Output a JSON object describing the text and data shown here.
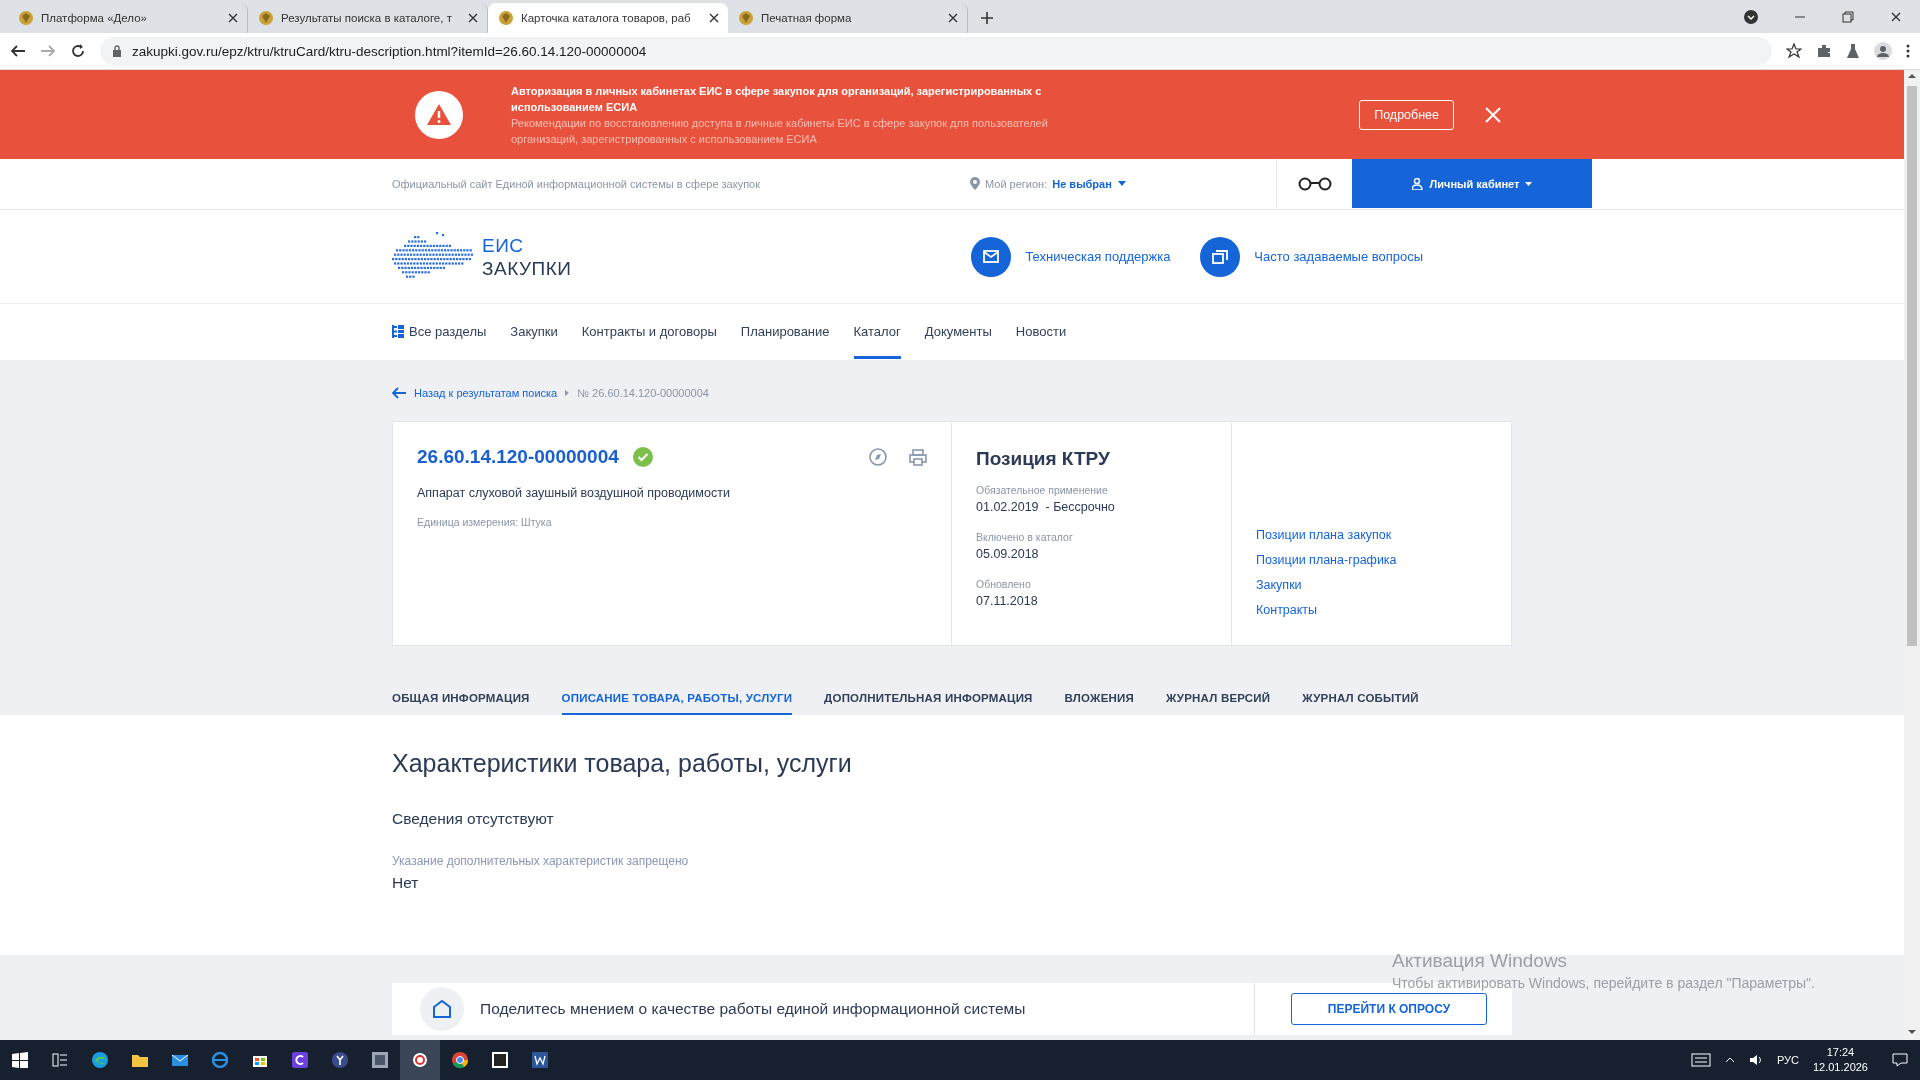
{
  "browser": {
    "tabs": [
      {
        "title": "Платформа «Дело»",
        "selected": false
      },
      {
        "title": "Результаты поиска в каталоге, т",
        "selected": false
      },
      {
        "title": "Карточка каталога товаров, раб",
        "selected": true
      },
      {
        "title": "Печатная форма",
        "selected": false
      }
    ],
    "url": "zakupki.gov.ru/epz/ktru/ktruCard/ktru-description.html?itemId=26.60.14.120-00000004"
  },
  "banner": {
    "title": "Авторизация в личных кабинетах ЕИС в сфере закупок для организаций, зарегистрированных с использованием ЕСИА",
    "text": "Рекомендации по восстановлению доступа в личные кабинеты ЕИС в сфере закупок для пользователей организаций, зарегистрированных с использованием ЕСИА",
    "button": "Подробнее"
  },
  "top_strip": {
    "site_name": "Официальный сайт Единой информационной системы в сфере закупок",
    "region_label": "Мой регион:",
    "region_value": "Не выбран",
    "account": "Личный кабинет"
  },
  "header": {
    "logo_top": "ЕИС",
    "logo_bottom": "ЗАКУПКИ",
    "support": "Техническая поддержка",
    "faq": "Часто задаваемые вопросы"
  },
  "nav": [
    {
      "label": "Все разделы",
      "selected": false
    },
    {
      "label": "Закупки",
      "selected": false
    },
    {
      "label": "Контракты и договоры",
      "selected": false
    },
    {
      "label": "Планирование",
      "selected": false
    },
    {
      "label": "Каталог",
      "selected": true
    },
    {
      "label": "Документы",
      "selected": false
    },
    {
      "label": "Новости",
      "selected": false
    }
  ],
  "breadcrumb": {
    "back": "Назад к результатам поиска",
    "current": "№ 26.60.14.120-00000004"
  },
  "card": {
    "code": "26.60.14.120-00000004",
    "verified": true,
    "name": "Аппарат слуховой заушный воздушной проводимости",
    "unit": "Единица измерения: Штука",
    "type_title": "Позиция КТРУ",
    "fields": [
      {
        "label": "Обязательное применение",
        "value": "01.02.2019  - Бессрочно"
      },
      {
        "label": "Включено в каталог",
        "value": "05.09.2018"
      },
      {
        "label": "Обновлено",
        "value": "07.11.2018"
      }
    ],
    "links": [
      "Позиции плана закупок",
      "Позиции плана-графика",
      "Закупки",
      "Контракты"
    ]
  },
  "tabs": [
    {
      "label": "ОБЩАЯ ИНФОРМАЦИЯ",
      "selected": false
    },
    {
      "label": "ОПИСАНИЕ ТОВАРА, РАБОТЫ, УСЛУГИ",
      "selected": true
    },
    {
      "label": "ДОПОЛНИТЕЛЬНАЯ ИНФОРМАЦИЯ",
      "selected": false
    },
    {
      "label": "ВЛОЖЕНИЯ",
      "selected": false
    },
    {
      "label": "ЖУРНАЛ ВЕРСИЙ",
      "selected": false
    },
    {
      "label": "ЖУРНАЛ СОБЫТИЙ",
      "selected": false
    }
  ],
  "content": {
    "title": "Характеристики товара, работы, услуги",
    "empty_text": "Сведения отсутствуют",
    "field_label": "Указание дополнительных характеристик запрещено",
    "field_value": "Нет"
  },
  "survey": {
    "text": "Поделитесь мнением о качестве работы единой информационной системы",
    "button": "ПЕРЕЙТИ К ОПРОСУ"
  },
  "windows_notice": {
    "title": "Активация Windows",
    "text": "Чтобы активировать Windows, перейдите в раздел \"Параметры\"."
  },
  "taskbar": {
    "language": "РУС",
    "time": "17:24",
    "date": "12.01.2026"
  }
}
